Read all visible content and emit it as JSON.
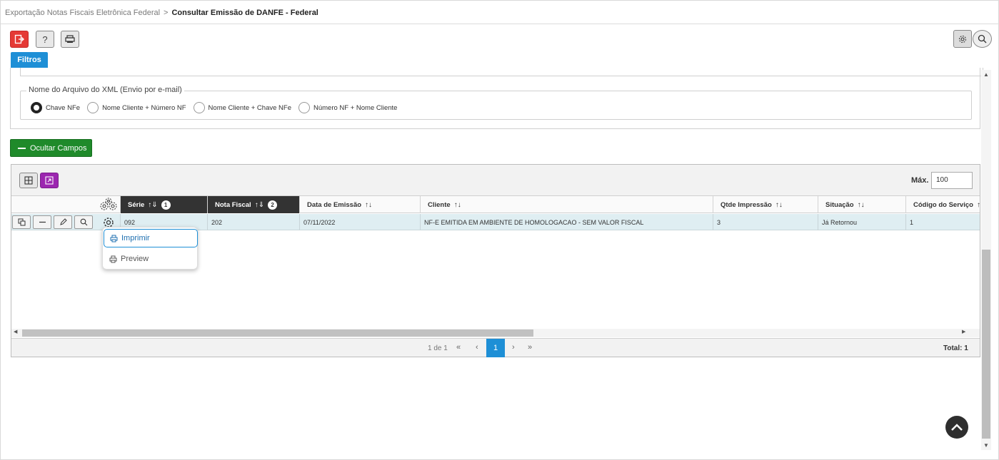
{
  "breadcrumb": {
    "parent": "Exportação Notas Fiscais Eletrônica Federal",
    "separator": ">",
    "current": "Consultar Emissão de DANFE - Federal"
  },
  "filters_tab": {
    "label": "Filtros"
  },
  "xml_filename": {
    "legend": "Nome do Arquivo do XML (Envio por e-mail)",
    "options": [
      {
        "label": "Chave NFe",
        "selected": true
      },
      {
        "label": "Nome Cliente + Número NF",
        "selected": false
      },
      {
        "label": "Nome Cliente + Chave NFe",
        "selected": false
      },
      {
        "label": "Número NF + Nome Cliente",
        "selected": false
      }
    ]
  },
  "hide_fields_button": {
    "label": "Ocultar Campos"
  },
  "grid": {
    "max_label": "Máx.",
    "max_value": "100",
    "columns": [
      {
        "label": "Série",
        "sort": "↑⇓",
        "badge": "1"
      },
      {
        "label": "Nota Fiscal",
        "sort": "↑⇓",
        "badge": "2"
      },
      {
        "label": "Data de Emissão",
        "sort": "↑↓"
      },
      {
        "label": "Cliente",
        "sort": "↑↓"
      },
      {
        "label": "Qtde Impressão",
        "sort": "↑↓"
      },
      {
        "label": "Situação",
        "sort": "↑↓"
      },
      {
        "label": "Código do Serviço",
        "sort": "↑↓"
      }
    ],
    "rows": [
      {
        "serie": "092",
        "nota_fiscal": "202",
        "data_emissao": "07/11/2022",
        "cliente": "NF-E EMITIDA EM AMBIENTE DE HOMOLOGACAO - SEM VALOR FISCAL",
        "qtde_impressao": "3",
        "situacao": "Já Retornou",
        "codigo_servico": "1"
      }
    ],
    "row_menu": [
      {
        "label": "Imprimir",
        "active": true
      },
      {
        "label": "Preview",
        "active": false
      }
    ],
    "pager": {
      "info": "1 de 1",
      "first": "«",
      "prev": "‹",
      "current": "1",
      "next": "›",
      "last": "»",
      "total_label": "Total: 1"
    }
  },
  "colors": {
    "accent_blue": "#1e8fd6",
    "danger_red": "#e53935",
    "success_green": "#1f8a2a",
    "purple": "#9c27b0",
    "header_dark": "#333333",
    "row_selected": "#dfeef2"
  },
  "icons": [
    "exit-icon",
    "help-icon",
    "printer-icon",
    "settings-icon",
    "search-icon",
    "grid-icon",
    "expand-icon",
    "gear-icon",
    "copy-icon",
    "minus-icon",
    "edit-icon",
    "chevron-up-icon"
  ]
}
